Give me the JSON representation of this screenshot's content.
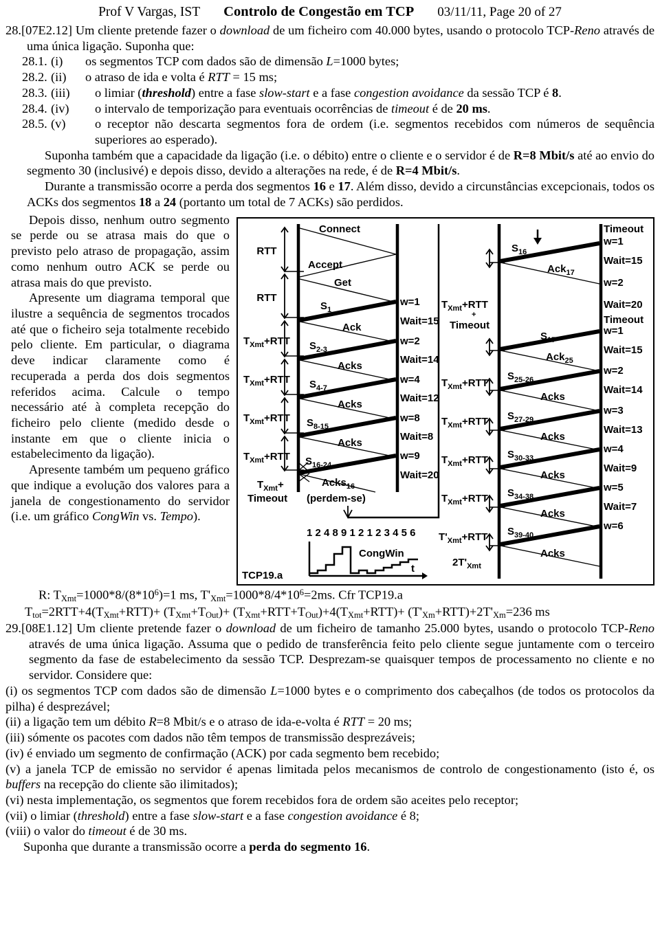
{
  "header": {
    "author": "Prof V Vargas, IST",
    "title": "Controlo de Congestão em TCP",
    "pageinfo": "03/11/11, Page 20 of 27"
  },
  "q28": {
    "number": "28.",
    "code": "[07E2.12]",
    "lead_a": " Um cliente pretende fazer o ",
    "lead_dl": "download",
    "lead_b": " de um ficheiro com 40.000 bytes, usando o protocolo TCP-",
    "lead_reno": "Reno",
    "lead_c": " através de uma única ligação. Suponha que:",
    "items": [
      {
        "num": "28.1.",
        "rom": "(i)",
        "text": "os segmentos TCP com dados são de dimensão L=1000 bytes;"
      },
      {
        "num": "28.2.",
        "rom": "(ii)",
        "text": "o atraso de ida e volta é RTT = 15 ms;"
      },
      {
        "num": "28.3.",
        "rom": "(iii)",
        "text": "o limiar (threshold) entre a fase slow-start e a fase congestion avoidance da sessão TCP é 8."
      },
      {
        "num": "28.4.",
        "rom": "(iv)",
        "text": "o intervalo de temporização para eventuais ocorrências de timeout é de 20 ms."
      },
      {
        "num": "28.5.",
        "rom": "(v)",
        "text": "o receptor não descarta segmentos fora de ordem (i.e. segmentos recebidos com números de sequência superiores ao esperado)."
      }
    ],
    "p_cap_a": "Suponha também que a capacidade da ligação (i.e. o débito) entre o cliente e o servidor é de ",
    "p_cap_r8": "R=8 Mbit/s",
    "p_cap_b": " até ao envio do segmento 30 (inclusivé) e depois disso, devido a alterações na rede, é de ",
    "p_cap_r4": "R=4 Mbit/s",
    "p_cap_c": ".",
    "p_loss_a": "Durante a transmissão ocorre a perda dos segmentos ",
    "p_loss_16": "16",
    "p_loss_b": " e ",
    "p_loss_17": "17",
    "p_loss_c": ". Além disso, devido a circunstâncias excepcionais, todos os ACKs dos segmentos ",
    "p_loss_18": "18",
    "p_loss_d": " a ",
    "p_loss_24": "24",
    "p_loss_e": " (portanto um total de 7 ACKs) são perdidos.",
    "left_p1": "Depois disso, nenhum outro segmento se perde ou se atrasa mais do que o previsto pelo atraso de propagação, assim como nenhum outro ACK se perde ou atrasa mais do que previsto.",
    "left_p2_a": "Apresente um diagrama temporal que ilustre a sequência de segmentos trocados até que o ficheiro seja totalmente recebido pelo cliente. Em particular, o diagrama deve indicar claramente como é recuperada a perda dos dois segmentos referidos acima. Calcule o tempo necessário até à completa recepção do ficheiro pelo cliente (medido desde o instante em que o cliente inicia o estabelecimento da ligação).",
    "left_p3_a": "Apresente também um pequeno gráfico que indique a evolução dos valores para a janela de congestionamento do servidor (i.e. um gráfico ",
    "left_p3_cw": "CongWin",
    "left_p3_b": " vs. ",
    "left_p3_t": "Tempo",
    "left_p3_c": ").",
    "answer_line1_pre": "R: T",
    "answer_line1": "=1000*8/(8*10",
    "answer_line1_mid": ")=1 ms, T'",
    "answer_line1_b": "=1000*8/4*10",
    "answer_line1_end": "=2ms. Cfr TCP19.a",
    "answer_line2_pre": "T",
    "answer_line2": "=2RTT+4(T",
    "answer_total": "=236 ms"
  },
  "figure": {
    "label": "TCP19.a",
    "left_panel": {
      "time_labels": [
        "RTT",
        "RTT",
        "TXmt+RTT",
        "TXmt+RTT",
        "TXmt+RTT",
        "TXmt+RTT",
        "TXmt+Timeout"
      ],
      "messages": [
        "Connect",
        "Accept",
        "Get",
        "S1",
        "Ack",
        "S2-3",
        "Acks",
        "S4-7",
        "Acks",
        "S8-15",
        "Acks",
        "S16-24",
        "Acks16",
        "(perdem-se)"
      ],
      "window_labels": [
        "w=1",
        "Wait=15",
        "w=2",
        "Wait=14",
        "w=4",
        "Wait=12",
        "w=8",
        "Wait=8",
        "w=9",
        "Wait=20"
      ]
    },
    "right_panel": {
      "time_labels": [
        "TXmt+RTT+Timeout",
        "TXmt+RTT",
        "TXmt+RTT",
        "TXmt+RTT",
        "TXmt+RTT",
        "T'Xmt+RTT",
        "2T'Xmt"
      ],
      "messages": [
        "S16",
        "Ack17",
        "S17",
        "Ack25",
        "S25-26",
        "Acks",
        "S27-29",
        "Acks",
        "S30-33",
        "Acks",
        "S34-38",
        "Acks",
        "S39-40",
        "Acks"
      ],
      "window_labels": [
        "Timeout",
        "w=1",
        "Wait=15",
        "w=2",
        "Wait=20",
        "Timeout",
        "w=1",
        "Wait=15",
        "w=2",
        "Wait=14",
        "w=3",
        "Wait=13",
        "w=4",
        "Wait=9",
        "w=5",
        "Wait=7",
        "w=6"
      ]
    },
    "congwin_chart": {
      "title": "CongWin",
      "xlabel": "t",
      "values_label": "1 2 4 8 9 1 2 1 2 3 4 5 6"
    }
  },
  "chart_data": {
    "type": "line",
    "title": "CongWin",
    "xlabel": "t",
    "ylabel": "",
    "categories": [
      "1",
      "2",
      "3",
      "4",
      "5",
      "6",
      "7",
      "8",
      "9",
      "10",
      "11",
      "12",
      "13"
    ],
    "tick_labels": [
      "1",
      "2",
      "4",
      "8",
      "9",
      "1",
      "2",
      "1",
      "2",
      "3",
      "4",
      "5",
      "6"
    ],
    "values": [
      1,
      2,
      4,
      8,
      9,
      1,
      2,
      1,
      2,
      3,
      4,
      5,
      6
    ],
    "ylim": [
      0,
      10
    ],
    "grid": false,
    "legend": "none"
  },
  "q29": {
    "number": "29.",
    "code": "[08E1.12]",
    "lead_a": " Um cliente pretende fazer o ",
    "lead_dl": "download",
    "lead_b": " de um ficheiro de tamanho 25.000 bytes, usando o protocolo TCP-",
    "lead_reno": "Reno",
    "lead_c": " através de uma única ligação. Assuma que o pedido de transferência feito pelo cliente segue juntamente com o terceiro segmento da fase de estabelecimento da sessão TCP. Desprezam-se quaisquer tempos de processamento no cliente e no servidor. Considere que:",
    "items": [
      "(i) os segmentos TCP com dados são de dimensão L=1000 bytes e o comprimento dos cabeçalhos (de todos os protocolos da pilha) é desprezável;",
      "(ii) a ligação tem um débito R=8 Mbit/s e o atraso de ida-e-volta é RTT = 20 ms;",
      "(iii) sómente os pacotes com dados não têm tempos de transmissão desprezáveis;",
      "(iv) é enviado um segmento de confirmação (ACK) por cada segmento bem recebido;",
      "(v) a janela TCP de emissão no servidor é apenas limitada pelos mecanismos de controlo de congestionamento (isto é, os buffers na recepção do cliente são ilimitados);",
      "(vi) nesta implementação, os segmentos que forem recebidos fora de ordem são aceites pelo receptor;",
      "(vii) o limiar (threshold) entre a fase slow-start e a fase congestion avoidance é 8;",
      "(viii) o valor do timeout é de 30 ms."
    ],
    "last_a": "Suponha que durante a transmissão ocorre a ",
    "last_b": "perda do segmento 16",
    "last_c": "."
  }
}
